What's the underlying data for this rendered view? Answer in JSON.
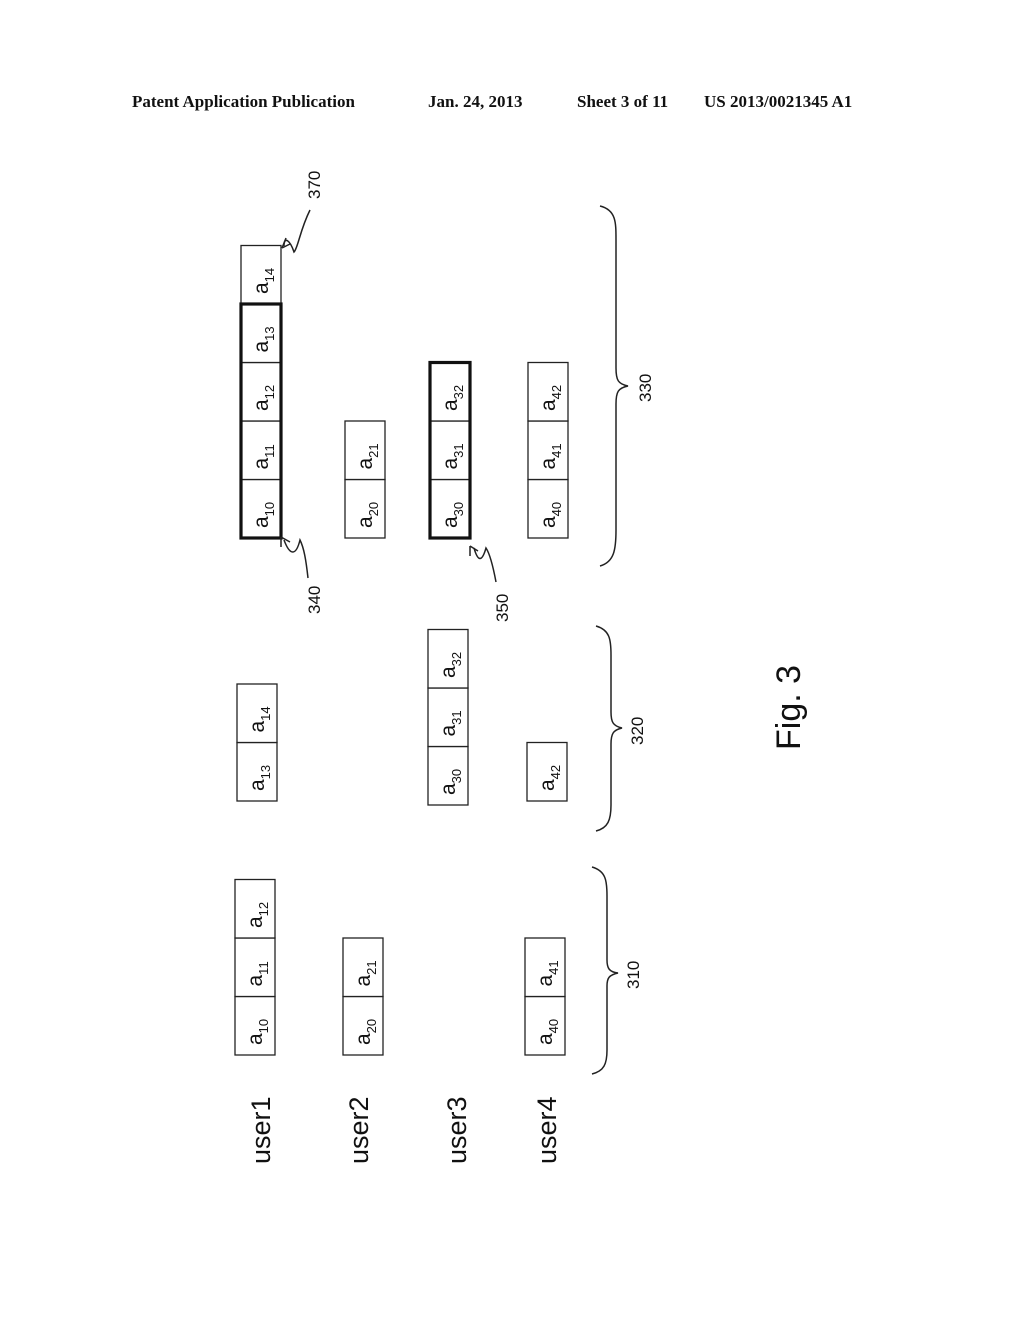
{
  "header": {
    "left": "Patent Application Publication",
    "center": "Jan. 24, 2013",
    "sheet": "Sheet 3 of 11",
    "right": "US 2013/0021345 A1"
  },
  "figure": {
    "caption": "Fig. 3",
    "users": [
      "user1",
      "user2",
      "user3",
      "user4"
    ],
    "groups": [
      {
        "ref": "310",
        "rows": [
          {
            "user": "user1",
            "cells": [
              "10",
              "11",
              "12"
            ]
          },
          {
            "user": "user2",
            "cells": [
              "20",
              "21"
            ]
          },
          {
            "user": "user3",
            "cells": []
          },
          {
            "user": "user4",
            "cells": [
              "40",
              "41"
            ]
          }
        ]
      },
      {
        "ref": "320",
        "rows": [
          {
            "user": "user1",
            "cells": [
              "13",
              "14"
            ]
          },
          {
            "user": "user2",
            "cells": []
          },
          {
            "user": "user3",
            "cells": [
              "30",
              "31",
              "32"
            ]
          },
          {
            "user": "user4",
            "cells": [
              "42"
            ]
          }
        ]
      },
      {
        "ref": "330",
        "rows": [
          {
            "user": "user1",
            "cells": [
              "10",
              "11",
              "12",
              "13",
              "14"
            ],
            "highlighted": [
              "10",
              "11",
              "12",
              "13"
            ]
          },
          {
            "user": "user2",
            "cells": [
              "20",
              "21"
            ]
          },
          {
            "user": "user3",
            "cells": [
              "30",
              "31",
              "32"
            ],
            "highlighted": [
              "30",
              "31",
              "32"
            ]
          },
          {
            "user": "user4",
            "cells": [
              "40",
              "41",
              "42"
            ]
          }
        ]
      }
    ],
    "callouts": [
      {
        "ref": "340",
        "target": "highlighted block a10-a13 (user1)"
      },
      {
        "ref": "350",
        "target": "highlighted block a30-a32 (user3)"
      },
      {
        "ref": "370",
        "target": "cell a14 (user1)"
      }
    ],
    "cell_prefix": "a"
  }
}
